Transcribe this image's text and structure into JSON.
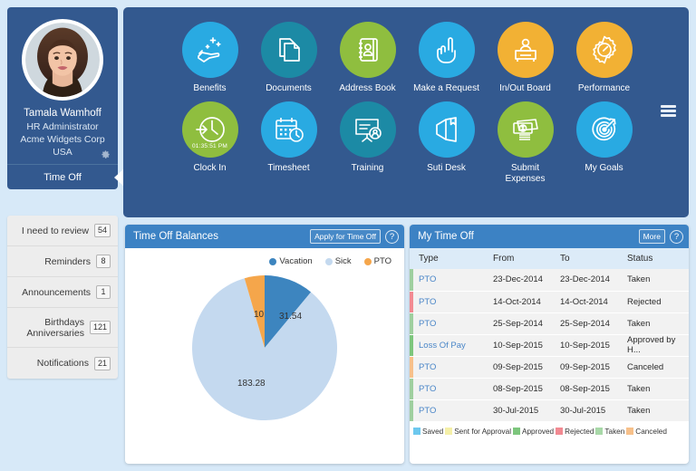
{
  "profile": {
    "name": "Tamala Wamhoff",
    "role": "HR Administrator",
    "company": "Acme Widgets Corp",
    "country": "USA",
    "settings_icon": "gear-icon",
    "tab_label": "Time Off"
  },
  "sidebar": {
    "items": [
      {
        "label": "I need to review",
        "badge": "54"
      },
      {
        "label": "Reminders",
        "badge": "8"
      },
      {
        "label": "Announcements",
        "badge": "1"
      },
      {
        "label": "Birthdays",
        "label2": "Anniversaries",
        "badge": "121"
      },
      {
        "label": "Notifications",
        "badge": "21"
      }
    ]
  },
  "apps": {
    "menu_icon": "hamburger-icon",
    "tiles": [
      {
        "label": "Benefits",
        "icon": "hand-sparkle-icon",
        "color": "#29AAE2"
      },
      {
        "label": "Documents",
        "icon": "documents-icon",
        "color": "#1C8AA5"
      },
      {
        "label": "Address Book",
        "icon": "address-book-icon",
        "color": "#8FBE3F"
      },
      {
        "label": "Make a Request",
        "icon": "pointing-hand-icon",
        "color": "#29AAE2"
      },
      {
        "label": "In/Out Board",
        "icon": "desk-person-icon",
        "color": "#F2B134"
      },
      {
        "label": "Performance",
        "icon": "gauge-gear-icon",
        "color": "#F2B134"
      },
      {
        "label": "Clock In",
        "icon": "clock-arrow-icon",
        "color": "#8FBE3F",
        "time": "01:35:51 PM"
      },
      {
        "label": "Timesheet",
        "icon": "calendar-clock-icon",
        "color": "#29AAE2"
      },
      {
        "label": "Training",
        "icon": "whiteboard-icon",
        "color": "#1C8AA5"
      },
      {
        "label": "Suti Desk",
        "icon": "ticket-icon",
        "color": "#29AAE2"
      },
      {
        "label": "Submit",
        "label2": "Expenses",
        "icon": "money-icon",
        "color": "#8FBE3F"
      },
      {
        "label": "My Goals",
        "icon": "target-arrow-icon",
        "color": "#29AAE2"
      }
    ]
  },
  "balances_panel": {
    "title": "Time Off Balances",
    "apply_label": "Apply for Time Off",
    "help_label": "?"
  },
  "chart_data": {
    "type": "pie",
    "title": "Time Off Balances",
    "categories": [
      "Vacation",
      "Sick",
      "PTO"
    ],
    "values": [
      31.54,
      183.28,
      10
    ],
    "colors": [
      "#3D85BF",
      "#C4D9EF",
      "#F5A64B"
    ],
    "labels": [
      "31.54",
      "183.28",
      "10"
    ],
    "legend_position": "top-right"
  },
  "timeoff_panel": {
    "title": "My Time Off",
    "more_label": "More",
    "help_label": "?",
    "columns": [
      "Type",
      "From",
      "To",
      "Status"
    ],
    "rows": [
      {
        "type": "PTO",
        "from": "23-Dec-2014",
        "to": "23-Dec-2014",
        "status": "Taken",
        "bar": "#9FCF9F"
      },
      {
        "type": "PTO",
        "from": "14-Oct-2014",
        "to": "14-Oct-2014",
        "status": "Rejected",
        "bar": "#F28A92"
      },
      {
        "type": "PTO",
        "from": "25-Sep-2014",
        "to": "25-Sep-2014",
        "status": "Taken",
        "bar": "#9FCF9F"
      },
      {
        "type": "Loss Of Pay",
        "from": "10-Sep-2015",
        "to": "10-Sep-2015",
        "status": "Approved by H...",
        "bar": "#7DC67D"
      },
      {
        "type": "PTO",
        "from": "09-Sep-2015",
        "to": "09-Sep-2015",
        "status": "Canceled",
        "bar": "#F7C08A"
      },
      {
        "type": "PTO",
        "from": "08-Sep-2015",
        "to": "08-Sep-2015",
        "status": "Taken",
        "bar": "#9FCF9F"
      },
      {
        "type": "PTO",
        "from": "30-Jul-2015",
        "to": "30-Jul-2015",
        "status": "Taken",
        "bar": "#9FCF9F"
      }
    ],
    "legend": [
      {
        "label": "Saved",
        "color": "#6DC8EE"
      },
      {
        "label": "Sent for Approval",
        "color": "#F5F0A8"
      },
      {
        "label": "Approved",
        "color": "#7DC67D"
      },
      {
        "label": "Rejected",
        "color": "#F28A92"
      },
      {
        "label": "Taken",
        "color": "#A8D8A8"
      },
      {
        "label": "Canceled",
        "color": "#F7C08A"
      }
    ]
  }
}
